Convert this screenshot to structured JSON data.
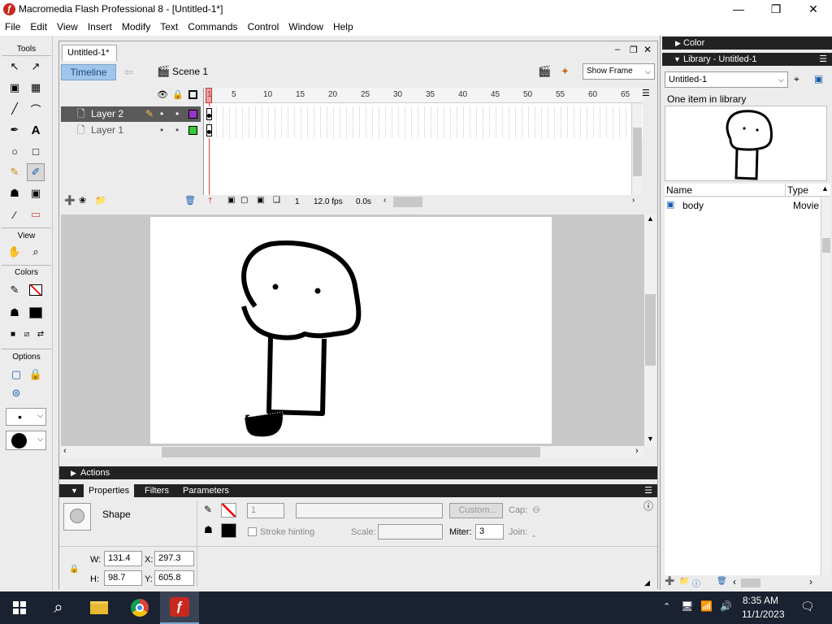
{
  "window": {
    "title": "Macromedia Flash Professional 8 - [Untitled-1*]",
    "app_icon": "ƒ"
  },
  "menu": [
    "File",
    "Edit",
    "View",
    "Insert",
    "Modify",
    "Text",
    "Commands",
    "Control",
    "Window",
    "Help"
  ],
  "tools": {
    "header": "Tools",
    "view_label": "View",
    "colors_label": "Colors",
    "options_label": "Options"
  },
  "document": {
    "tab": "Untitled-1*",
    "timeline_button": "Timeline",
    "scene": "Scene 1",
    "show_frame": "Show Frame"
  },
  "timeline": {
    "layers": [
      {
        "name": "Layer 2",
        "active": true,
        "color": "#9933cc"
      },
      {
        "name": "Layer 1",
        "active": false,
        "color": "#33cc33"
      }
    ],
    "ruler": [
      "1",
      "5",
      "10",
      "15",
      "20",
      "25",
      "30",
      "35",
      "40",
      "45",
      "50",
      "55",
      "60",
      "65"
    ],
    "current_frame": "1",
    "fps": "12.0 fps",
    "elapsed": "0.0s"
  },
  "actions_label": "Actions",
  "properties": {
    "tabs": [
      "Properties",
      "Filters",
      "Parameters"
    ],
    "kind": "Shape",
    "stroke_size": "1",
    "custom_button": "Custom...",
    "cap_label": "Cap:",
    "stroke_hinting": "Stroke hinting",
    "scale_label": "Scale:",
    "miter_label": "Miter:",
    "miter_value": "3",
    "join_label": "Join:",
    "w_label": "W:",
    "w_value": "131.4",
    "h_label": "H:",
    "h_value": "98.7",
    "x_label": "X:",
    "x_value": "297.3",
    "y_label": "Y:",
    "y_value": "605.8"
  },
  "panels": {
    "color_header": "Color",
    "library_header": "Library - Untitled-1",
    "library_select": "Untitled-1",
    "library_count": "One item in library",
    "col_name": "Name",
    "col_type": "Type",
    "items": [
      {
        "name": "body",
        "type": "Movie"
      }
    ]
  },
  "taskbar": {
    "time": "8:35 AM",
    "date": "11/1/2023"
  }
}
